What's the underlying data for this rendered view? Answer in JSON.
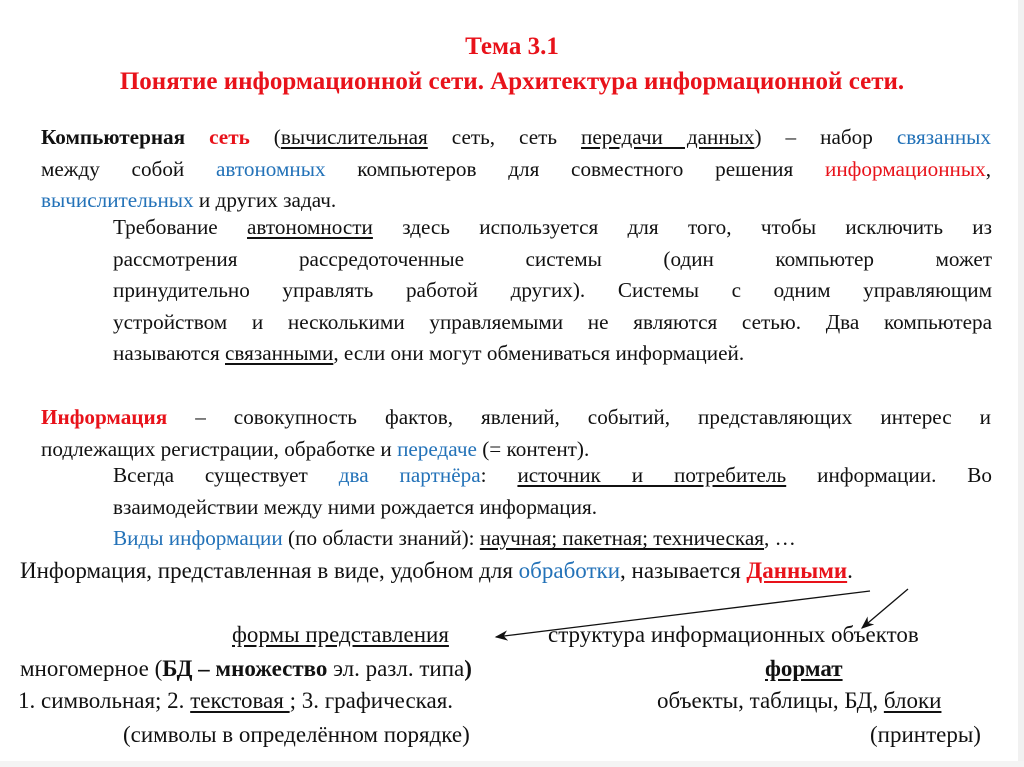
{
  "title": {
    "line1": "Тема 3.1",
    "line2": "Понятие информационной сети. Архитектура информационной сети."
  },
  "network_def": {
    "term_bold": "Компьютерная",
    "term_red": "сеть",
    "open_paren": " (",
    "syn1": "вычислительная",
    "mid1": " сеть, сеть ",
    "syn2": "передачи данных",
    "mid2": ") – набор ",
    "linked": "связанных",
    "line2_a": "между собой ",
    "autonomous": "автономных",
    "line2_b": " компьютеров для совместного решения ",
    "informational": "информационных",
    "comma": ",",
    "computational": "вычислительных",
    "line3_rest": " и других задач."
  },
  "autonomy": {
    "l1_a": "Требование ",
    "l1_u": "автономности",
    "l1_b": " здесь используется для того, чтобы исключить из",
    "l2": "рассмотрения рассредоточенные системы (один компьютер может",
    "l3": "принудительно управлять работой других). Системы с одним управляющим",
    "l4": "устройством и несколькими управляемыми не являются сетью. Два компьютера",
    "l5_a": "называются ",
    "l5_u": "связанными",
    "l5_b": ", если они могут обмениваться информацией."
  },
  "information_def": {
    "term": "Информация",
    "l1_rest": " – совокупность фактов, явлений, событий, представляющих интерес и",
    "l2_a": "подлежащих регистрации, обработке и ",
    "l2_blue": "передаче",
    "l2_b": " (= контент)."
  },
  "partners": {
    "l1_a": "Всегда существует ",
    "l1_blue": "два партнёра",
    "l1_colon": ": ",
    "l1_u": "источник и потребитель",
    "l1_b": " информации. Во",
    "l2": "взаимодействии между ними рождается информация.",
    "l3_blue": "Виды информации",
    "l3_a": " (по области знаний): ",
    "l3_u": "научная; пакетная; техническая",
    "l3_b": ", …"
  },
  "data_section": {
    "info_a": "Информация, представленная в виде, удобном для ",
    "info_blue": "обработки",
    "info_b": ", называется ",
    "info_red": "Данными",
    "info_end": ".",
    "forms": "формы представления",
    "structure": "структура информационных объектов",
    "multi_a": "многомерное (",
    "multi_bd": "БД – множество",
    "multi_b": " эл. разл. типа",
    "multi_close": ")",
    "format": "формат",
    "types_1": "1. символьная;  2. ",
    "types_u": "текстовая ",
    "types_2": ";  3. графическая.",
    "objects_a": "объекты, таблицы, БД, ",
    "objects_u": "блоки",
    "symbols": "(символы в определённом порядке)",
    "printers": "(принтеры)"
  },
  "colors": {
    "accent_red": "#e8121a",
    "accent_blue": "#2372b8",
    "text": "#111111"
  }
}
